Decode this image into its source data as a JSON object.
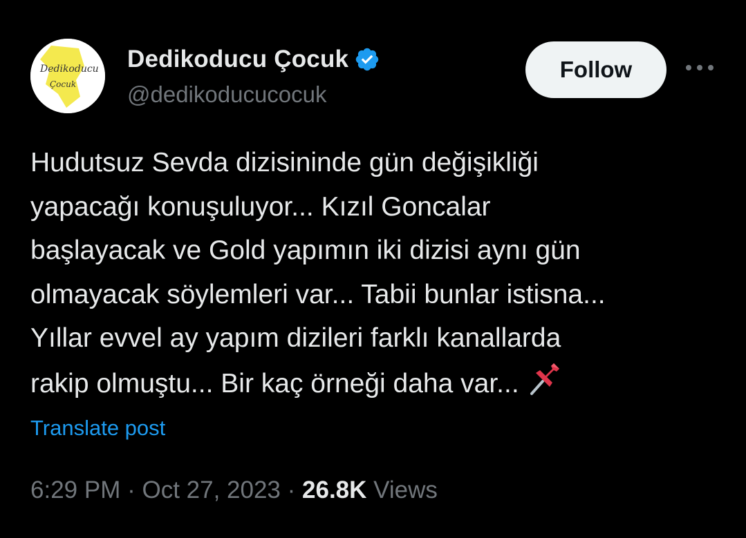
{
  "author": {
    "display_name": "Dedikoducu Çocuk",
    "handle": "@dedikoducucocuk",
    "verified": true,
    "avatar_text_line1": "Dedikoducu",
    "avatar_text_line2": "Çocuk"
  },
  "follow_label": "Follow",
  "post": {
    "lines": [
      "Hudutsuz Sevda dizisininde gün değişikliği",
      "yapacağı konuşuluyor... Kızıl Goncalar",
      "başlayacak ve Gold yapımın iki dizisi aynı gün",
      "olmayacak söylemleri var... Tabii bunlar istisna...",
      "Yıllar evvel ay yapım dizileri farklı kanallarda",
      "rakip olmuştu... Bir kaç örneği daha var..."
    ],
    "emoji": "pushpin-icon"
  },
  "translate_label": "Translate post",
  "meta": {
    "time": "6:29 PM",
    "separator": "·",
    "date": "Oct 27, 2023",
    "views_count": "26.8K",
    "views_label": "Views"
  },
  "colors": {
    "background": "#000000",
    "text": "#e7e9ea",
    "muted": "#71767b",
    "link": "#1d9bf0",
    "verified": "#1d9bf0",
    "follow_bg": "#eff3f4"
  }
}
